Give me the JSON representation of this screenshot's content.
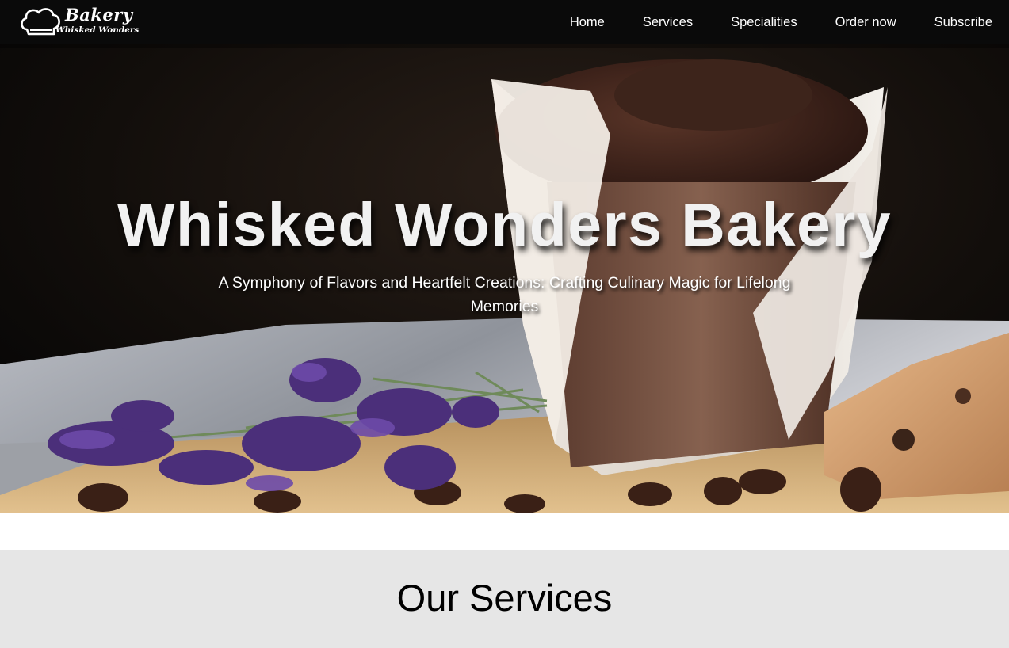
{
  "brand": {
    "logo_title": "Bakery",
    "logo_subtitle": "Whisked Wonders"
  },
  "nav": {
    "items": [
      {
        "label": "Home"
      },
      {
        "label": "Services"
      },
      {
        "label": "Specialities"
      },
      {
        "label": "Order now"
      },
      {
        "label": "Subscribe"
      }
    ]
  },
  "hero": {
    "title": "Whisked Wonders Bakery",
    "subtitle": "A Symphony of Flavors and Heartfelt Creations: Crafting Culinary Magic for Lifelong Memories"
  },
  "services": {
    "heading": "Our Services"
  },
  "colors": {
    "navbar_bg": "#0a0a0a",
    "services_bg": "#e6e6e6",
    "hero_text": "#f1f1f1"
  }
}
